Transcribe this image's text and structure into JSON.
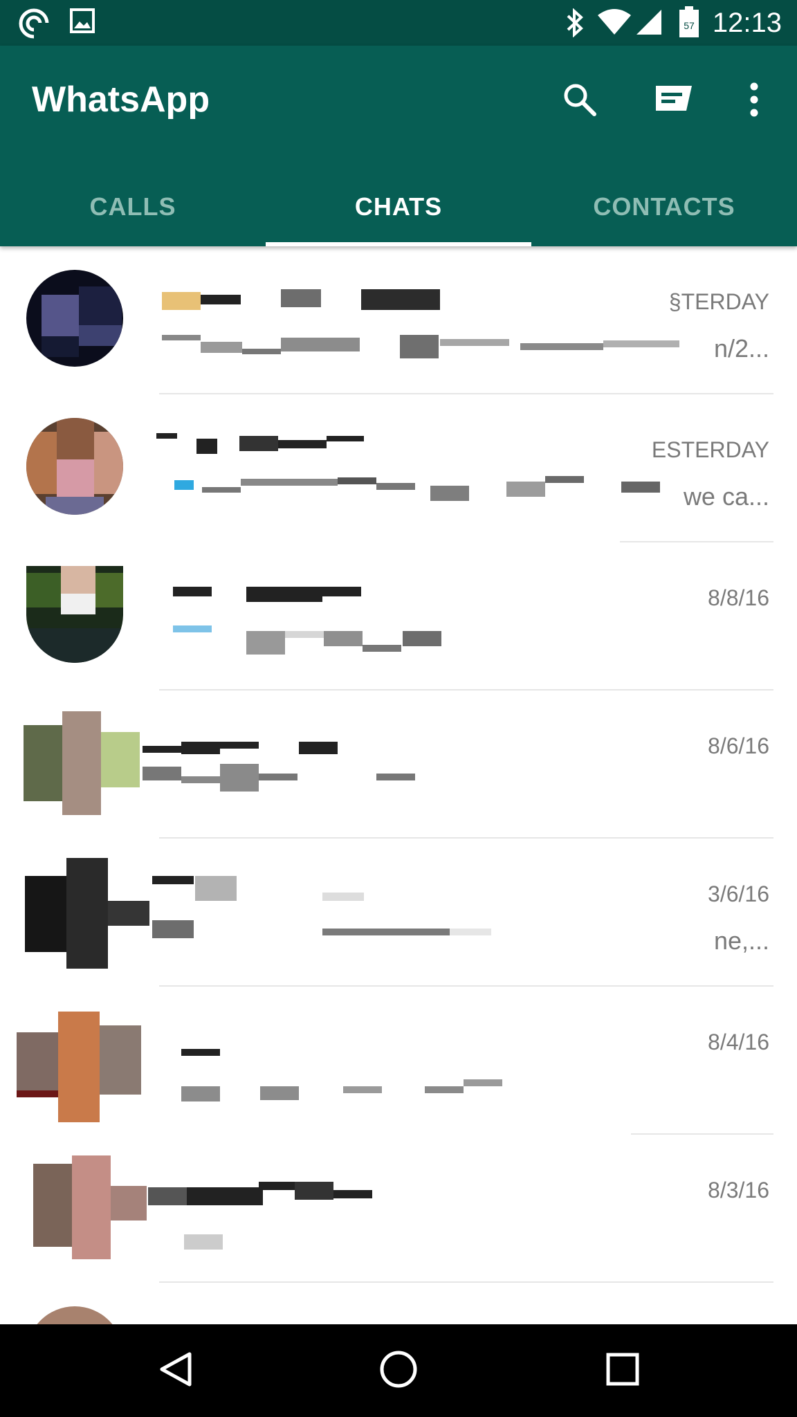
{
  "status_bar": {
    "time": "12:13",
    "battery_level": "57",
    "left_icons": [
      "cast-icon",
      "image-icon"
    ],
    "right_icons": [
      "bluetooth-icon",
      "wifi-icon",
      "cell-signal-icon",
      "battery-icon"
    ]
  },
  "app": {
    "title": "WhatsApp",
    "actions": [
      "search-icon",
      "new-chat-icon",
      "more-options-icon"
    ]
  },
  "tabs": [
    {
      "label": "CALLS",
      "active": false
    },
    {
      "label": "CHATS",
      "active": true
    },
    {
      "label": "CONTACTS",
      "active": false
    }
  ],
  "chats": [
    {
      "time": "§TERDAY",
      "snippet": "n/2..."
    },
    {
      "time": "ESTERDAY",
      "snippet": "we ca..."
    },
    {
      "time": "8/8/16",
      "snippet": ""
    },
    {
      "time": "8/6/16",
      "snippet": ""
    },
    {
      "time": "3/6/16",
      "snippet": "ne,..."
    },
    {
      "time": "8/4/16",
      "snippet": ""
    },
    {
      "time": "8/3/16",
      "snippet": ""
    }
  ],
  "nav": [
    "back-icon",
    "home-icon",
    "recents-icon"
  ],
  "colors": {
    "status_bar": "#054d44",
    "app_bar": "#075e54",
    "tab_inactive": "#8fbdb4",
    "tab_active": "#ffffff",
    "timestamp": "#7a7a7a"
  }
}
